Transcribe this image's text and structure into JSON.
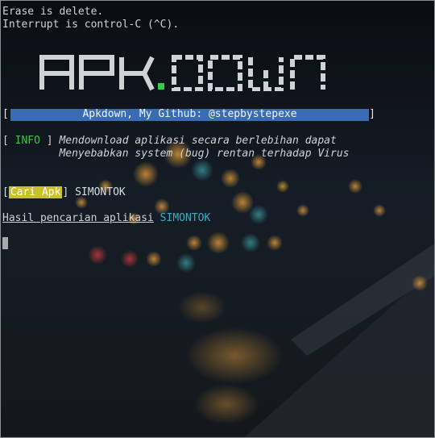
{
  "terminal": {
    "line1": "Erase is delete.",
    "line2": "Interrupt is control-C (^C).",
    "logo_left": "APK",
    "logo_dot": ".",
    "logo_right": "DOWN",
    "banner_text": "Apkdown, My Github: @stepbystepexe",
    "info_tag": "INFO",
    "info_line1": "Mendownload aplikasi secara berlebihan dapat",
    "info_line2": "Menyebabkan system (bug) rentan terhadap Virus",
    "search_label": "Cari Apk",
    "search_query": "SIMONTOK",
    "result_prefix": "Hasil pencarian aplikasi",
    "result_query": "SIMONTOK"
  },
  "colors": {
    "banner": "#3a6cb3",
    "info_tag": "#43c04a",
    "search_badge": "#c9c12a",
    "result_query": "#2fb3c4",
    "logo": "#cfd3d6",
    "logo_dot": "#2fd24b"
  }
}
